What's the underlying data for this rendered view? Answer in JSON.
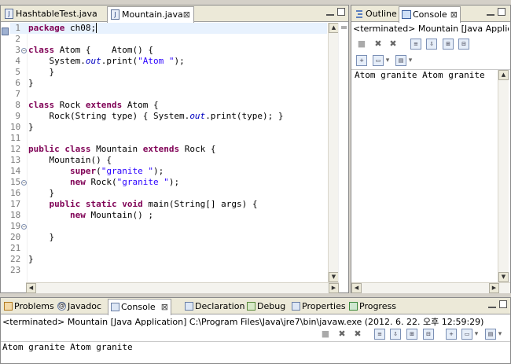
{
  "editor": {
    "tabs": [
      {
        "label": "HashtableTest.java",
        "active": false
      },
      {
        "label": "Mountain.java",
        "active": true,
        "close": "⊠"
      }
    ],
    "lines": [
      {
        "n": "1",
        "html": "<span class=\"kw\">package</span> ch08;"
      },
      {
        "n": "2",
        "html": ""
      },
      {
        "n": "3",
        "html": "<span class=\"kw\">class</span> Atom {    Atom() {"
      },
      {
        "n": "4",
        "html": "    System.<span class=\"it\">out</span>.print(<span class=\"str\">\"Atom \"</span>);"
      },
      {
        "n": "5",
        "html": "    }"
      },
      {
        "n": "6",
        "html": "}"
      },
      {
        "n": "7",
        "html": ""
      },
      {
        "n": "8",
        "html": "<span class=\"kw\">class</span> Rock <span class=\"kw\">extends</span> Atom {"
      },
      {
        "n": "9",
        "html": "    Rock(String type) { System.<span class=\"it\">out</span>.print(type); }"
      },
      {
        "n": "10",
        "html": "}"
      },
      {
        "n": "11",
        "html": ""
      },
      {
        "n": "12",
        "html": "<span class=\"kw\">public</span> <span class=\"kw\">class</span> Mountain <span class=\"kw\">extends</span> Rock {"
      },
      {
        "n": "13",
        "html": "    Mountain() {"
      },
      {
        "n": "14",
        "html": "        <span class=\"kw\">super</span>(<span class=\"str\">\"granite \"</span>);"
      },
      {
        "n": "15",
        "html": "        <span class=\"kw\">new</span> Rock(<span class=\"str\">\"granite \"</span>);"
      },
      {
        "n": "16",
        "html": "    }"
      },
      {
        "n": "17",
        "html": "    <span class=\"kw\">public</span> <span class=\"kw\">static</span> <span class=\"kw\">void</span> main(String[] args) {"
      },
      {
        "n": "18",
        "html": "        <span class=\"kw\">new</span> Mountain() ;"
      },
      {
        "n": "19",
        "html": ""
      },
      {
        "n": "20",
        "html": "    }"
      },
      {
        "n": "21",
        "html": ""
      },
      {
        "n": "22",
        "html": "}"
      },
      {
        "n": "23",
        "html": ""
      }
    ],
    "cursor_line": "1"
  },
  "right": {
    "tabs": [
      {
        "label": "Outline"
      },
      {
        "label": "Console",
        "close": "⊠"
      }
    ],
    "status": "<terminated> Mountain [Java Application",
    "output": "Atom granite Atom granite"
  },
  "bottom": {
    "tabs": [
      {
        "label": "Problems"
      },
      {
        "label": "Javadoc"
      },
      {
        "label": "Console",
        "close": "⊠"
      },
      {
        "label": "Declaration"
      },
      {
        "label": "Debug"
      },
      {
        "label": "Properties"
      },
      {
        "label": "Progress"
      }
    ],
    "status": "<terminated> Mountain [Java Application] C:\\Program Files\\Java\\jre7\\bin\\javaw.exe (2012. 6. 22. 오후 12:59:29)",
    "output": "Atom granite Atom granite"
  },
  "icons": {
    "java_file": "J",
    "at": "@",
    "menu_arrow": "▾"
  }
}
